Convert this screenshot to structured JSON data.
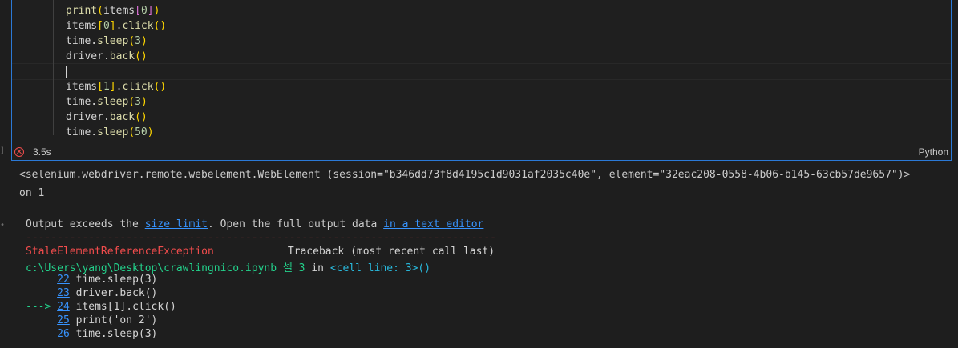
{
  "cell": {
    "code_lines": [
      "print(items[0])",
      "items[0].click()",
      "time.sleep(3)",
      "driver.back()",
      "",
      "items[1].click()",
      "time.sleep(3)",
      "driver.back()",
      "time.sleep(50)"
    ],
    "status_time": "3.5s",
    "language": "Python",
    "left_marker": "]"
  },
  "output": {
    "line1": "<selenium.webdriver.remote.webelement.WebElement (session=\"b346dd73f8d4195c1d9031af2035c40e\", element=\"32eac208-0558-4b06-b145-63cb57de9657\")>",
    "line2": "on 1",
    "exceeds_prefix": "Output exceeds the ",
    "size_limit_link": "size limit",
    "exceeds_middle": ". Open the full output data ",
    "text_editor_link": "in a text editor",
    "dashes": "---------------------------------------------------------------------------",
    "error_name": "StaleElementReferenceException",
    "traceback_label": "Traceback (most recent call last)",
    "file_path": "c:\\Users\\yang\\Desktop\\crawlingnico.ipynb 셀 3",
    "in_word": " in ",
    "cell_ref": "<cell line: 3>()",
    "tb": [
      {
        "arrow": "     ",
        "num": "22",
        "code": " time.sleep(3)"
      },
      {
        "arrow": "     ",
        "num": "23",
        "code": " driver.back()"
      },
      {
        "arrow": "---> ",
        "num": "24",
        "code": " items[1].click()"
      },
      {
        "arrow": "     ",
        "num": "25",
        "code": " print('on 2')"
      },
      {
        "arrow": "     ",
        "num": "26",
        "code": " time.sleep(3)"
      }
    ]
  }
}
